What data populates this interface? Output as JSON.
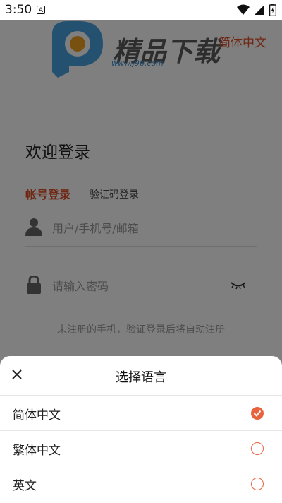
{
  "status_bar": {
    "time": "3:50",
    "a_icon": "A"
  },
  "header": {
    "brand_name": "精品下载",
    "brand_url": "www.j9p.com",
    "language_switch": "简体中文"
  },
  "login": {
    "welcome": "欢迎登录",
    "tab_account": "帐号登录",
    "tab_code": "验证码登录",
    "username_placeholder": "用户/手机号/邮箱",
    "password_placeholder": "请输入密码",
    "hint": "未注册的手机，验证登录后将自动注册"
  },
  "language_sheet": {
    "title": "选择语言",
    "options": [
      {
        "label": "简体中文",
        "selected": true
      },
      {
        "label": "繁体中文",
        "selected": false
      },
      {
        "label": "英文",
        "selected": false
      }
    ]
  },
  "colors": {
    "accent": "#e0502a",
    "overlay": "rgba(0,0,0,0.5)"
  }
}
